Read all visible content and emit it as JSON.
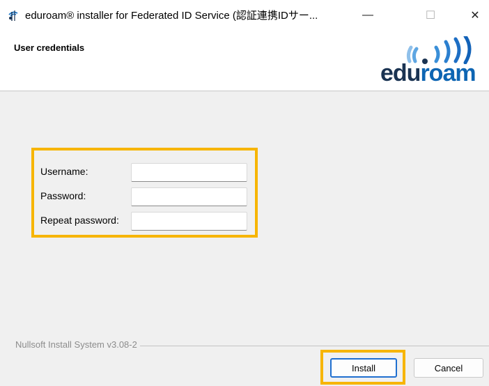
{
  "window": {
    "title": "eduroam® installer for Federated ID Service (認証連携IDサー...",
    "minimize_glyph": "—",
    "maximize_glyph": "☐",
    "close_glyph": "✕"
  },
  "header": {
    "title": "User credentials",
    "logo_text_a": "edu",
    "logo_text_b": "roam",
    "logo_colors": {
      "dark": "#1a3352",
      "blue": "#0d65b3"
    }
  },
  "form": {
    "fields": [
      {
        "label": "Username:",
        "value": ""
      },
      {
        "label": "Password:",
        "value": ""
      },
      {
        "label": "Repeat password:",
        "value": ""
      }
    ]
  },
  "footer": {
    "branding": "Nullsoft Install System v3.08-2",
    "install_label": "Install",
    "cancel_label": "Cancel"
  },
  "highlight_color": "#f7b500",
  "icons": [
    "eduroam-app-icon",
    "minimize-icon",
    "maximize-icon",
    "close-icon",
    "eduroam-logo"
  ]
}
